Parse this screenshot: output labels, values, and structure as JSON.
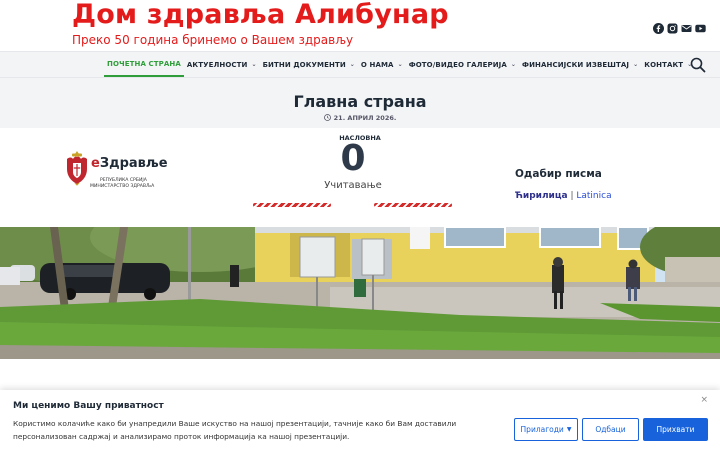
{
  "header": {
    "site_title": "Дом здравља Алибунар",
    "tagline": "Преко 50 година бринемо о Вашем здрављу",
    "social": [
      "facebook-icon",
      "instagram-icon",
      "mail-icon",
      "youtube-icon"
    ]
  },
  "nav": {
    "items": [
      {
        "label": "Почетна страна",
        "dropdown": false
      },
      {
        "label": "Актуелности",
        "dropdown": true
      },
      {
        "label": "Битни документи",
        "dropdown": true
      },
      {
        "label": "О нама",
        "dropdown": true
      },
      {
        "label": "Фото/видео галерија",
        "dropdown": true
      },
      {
        "label": "Финансијски извештај",
        "dropdown": true
      },
      {
        "label": "Контакт",
        "dropdown": true
      }
    ],
    "chevron": "⌄",
    "active_color": "#2f9e3a"
  },
  "page": {
    "title": "Главна страна",
    "date": "21. април 2026."
  },
  "ezdravlje": {
    "name_e": "е",
    "name_rest": "Здравље",
    "line1": "РЕПУБЛИКА СРБИЈА",
    "line2": "МИНИСТАРСТВО ЗДРАВЉА"
  },
  "counter": {
    "label": "НАСЛОВНА",
    "value": "0",
    "status": "Учитавање"
  },
  "script_picker": {
    "title": "Одабир писма",
    "cyrillic": "Ћирилица",
    "separator": " | ",
    "latin": "Latinica"
  },
  "cookie": {
    "title": "Ми ценимо Вашу приватност",
    "text": "Користимо колачиће како би унапредили Ваше искуство на нашој презентацији, тачније како би Вам доставили персонализован садржај и анализирамо проток информација ка нашој презентацији.",
    "close": "×",
    "customize": "Прилагоди",
    "reject": "Одбаци",
    "accept": "Прихвати",
    "accent": "#1863dc"
  }
}
